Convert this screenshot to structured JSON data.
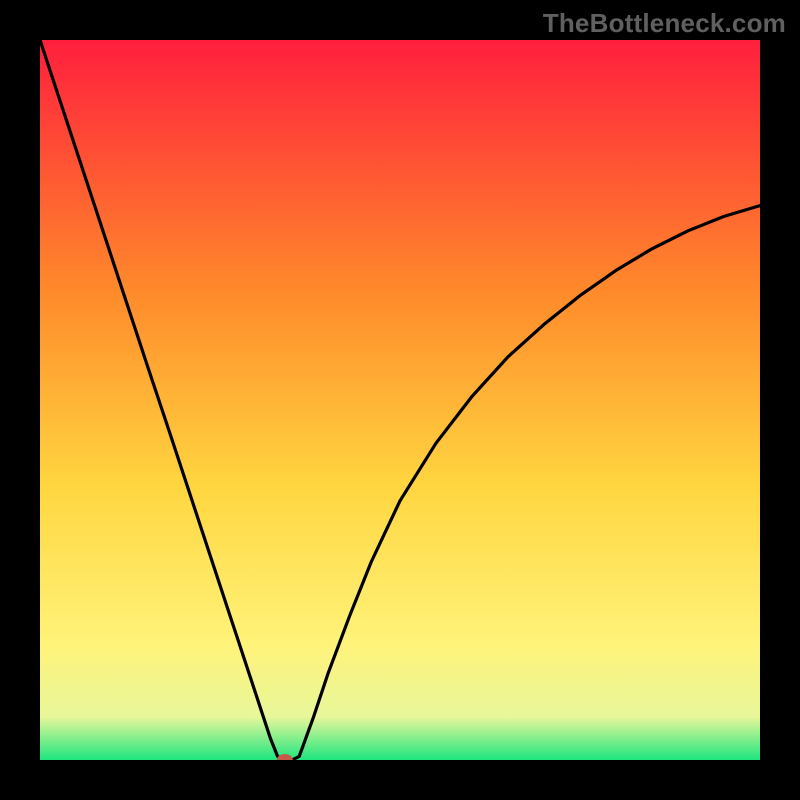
{
  "watermark": "TheBottleneck.com",
  "chart_data": {
    "type": "line",
    "title": "",
    "xlabel": "",
    "ylabel": "",
    "xlim": [
      0,
      100
    ],
    "ylim": [
      0,
      100
    ],
    "gradient_colors": {
      "top": "#ff1f3d",
      "mid_upper": "#ff8a2b",
      "mid": "#ffd640",
      "mid_lower": "#fff37a",
      "near_bottom": "#e8f79a",
      "bottom": "#1ee57e"
    },
    "marker": {
      "x": 34.0,
      "y": 0.0,
      "color": "#c85a4a"
    },
    "series": [
      {
        "name": "curve",
        "color": "#000000",
        "x": [
          0.0,
          3.0,
          6.0,
          9.0,
          12.0,
          15.0,
          18.0,
          21.0,
          24.0,
          27.0,
          30.0,
          32.0,
          33.0,
          34.0,
          35.0,
          36.0,
          38.0,
          40.0,
          43.0,
          46.0,
          50.0,
          55.0,
          60.0,
          65.0,
          70.0,
          75.0,
          80.0,
          85.0,
          90.0,
          95.0,
          100.0
        ],
        "y": [
          100.0,
          90.9,
          81.8,
          72.7,
          63.6,
          54.5,
          45.5,
          36.4,
          27.3,
          18.2,
          9.1,
          3.0,
          0.5,
          0.0,
          0.0,
          0.5,
          6.0,
          12.0,
          20.0,
          27.5,
          36.0,
          44.0,
          50.5,
          56.0,
          60.5,
          64.5,
          68.0,
          71.0,
          73.5,
          75.5,
          77.0
        ]
      }
    ]
  }
}
